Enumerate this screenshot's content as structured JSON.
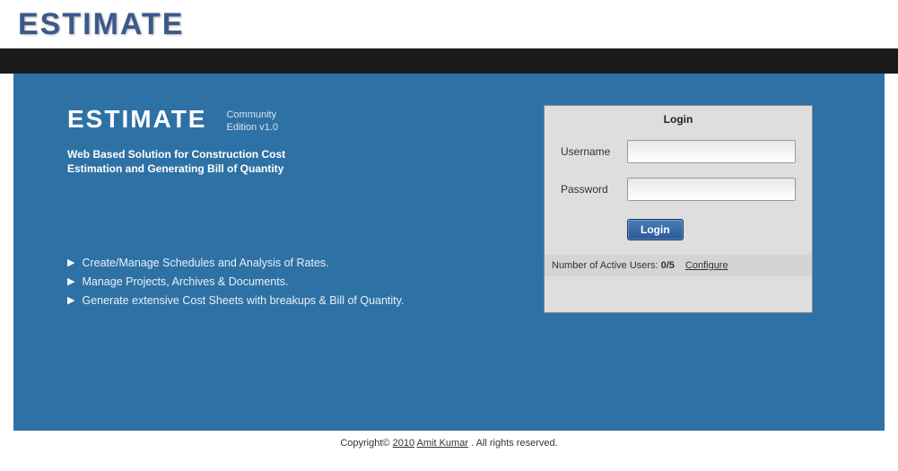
{
  "header": {
    "logo": "ESTIMATE"
  },
  "hero": {
    "title": "ESTIMATE",
    "edition_line1": "Community",
    "edition_line2": "Edition v1.0",
    "tagline_line1": "Web Based Solution for Construction Cost",
    "tagline_line2": "Estimation and Generating Bill of Quantity"
  },
  "features": [
    "Create/Manage Schedules and Analysis of Rates.",
    "Manage Projects, Archives & Documents.",
    "Generate extensive Cost Sheets with breakups & Bill of Quantity."
  ],
  "login": {
    "title": "Login",
    "username_label": "Username",
    "username_value": "",
    "password_label": "Password",
    "password_value": "",
    "button": "Login",
    "active_users_label": "Number of Active Users:",
    "active_users_value": "0/5",
    "configure": "Configure"
  },
  "footer": {
    "copyright": "Copyright©",
    "year": "2010",
    "author": "Amit Kumar",
    "rights": ". All rights reserved."
  }
}
